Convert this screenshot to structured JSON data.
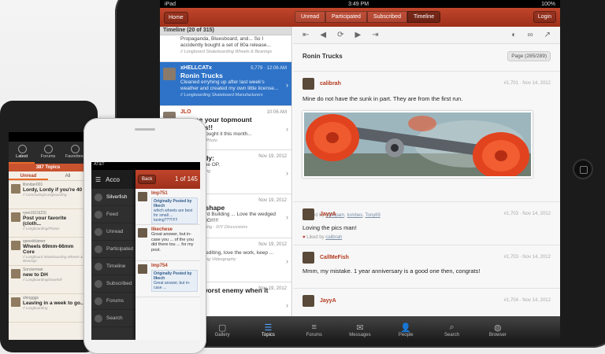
{
  "ipad": {
    "status": {
      "carrier": "iPad",
      "time": "3:49 PM",
      "battery": "100%"
    },
    "nav": {
      "home_label": "Home",
      "segments": [
        "Unread",
        "Participated",
        "Subscribed",
        "Timeline"
      ],
      "active_segment": "Timeline",
      "login_label": "Login"
    },
    "timeline_header": "Timeline (20 of 315)",
    "topics": [
      {
        "author": "",
        "meta": "",
        "title": "",
        "excerpt": "Propaganda, Bluesboard, and... So I accidently bought a set of 80a release...",
        "forum": "// Longboard Skateboarding Wheels & Bearings"
      },
      {
        "author": "xHELLCATx",
        "meta": "5,779 · 12:06 AM",
        "title": "Ronin Trucks",
        "excerpt": "Cleaned erryhing up after last week's weather and created my own little license...",
        "forum": "// Longboarding Skateboard Manufacturers"
      },
      {
        "author": "JLO",
        "meta": "10:06 AM",
        "title": "...w me your topmount ...boards!!",
        "excerpt": "...e mine, bought it this month...",
        "forum": "// Longboard Photo"
      },
      {
        "author": "",
        "meta": "Nov 19, 2012",
        "title": "...erybody:",
        "excerpt": "...cture of the OP.",
        "forum": "// Longboarding"
      },
      {
        "author": "...rederf",
        "meta": "Nov 19, 2012",
        "title": "...ck on shape",
        "excerpt": "...d for Board Building ... Love the wedged fro... JOKING!!!!!",
        "forum": "// Board Building · DIY Discussions"
      },
      {
        "author": "",
        "meta": "Nov 19, 2012",
        "title": "...88",
        "excerpt": "...ding and editing, love the work, keep ...",
        "forum": "// Longboarding Videography"
      },
      {
        "author": "",
        "meta": "Nov 19, 2012",
        "title": "...your worst enemy when it ...riding",
        "excerpt": "",
        "forum": ""
      }
    ],
    "toolbar": {
      "first": "⇤",
      "prev": "◀",
      "refresh": "⟳",
      "next": "▶",
      "last": "⇥",
      "like": "◐",
      "link": "∞",
      "share": "↗"
    },
    "thread_title": "Ronin Trucks",
    "page_badge": "Page (285/289)",
    "posts": [
      {
        "author": "calibrah",
        "meta": "#1,701 · Nov 14, 2012",
        "text": "Mine do not have the sunk in part. They are from the first run.",
        "liked": "Liked by",
        "likers": [
          "stiffspam",
          "tombes",
          "Tony89"
        ]
      },
      {
        "author": "JayyA",
        "meta": "#1,703 · Nov 14, 2012",
        "text": "Loving the pics man!",
        "liked": "Liked by",
        "likers": [
          "calibrah"
        ]
      },
      {
        "author": "CallMeFish",
        "meta": "#1,703 · Nov 14, 2012",
        "text": "Mmm, my mistake. 1 year anniversary is a good one then, congrats!",
        "liked": "",
        "likers": []
      },
      {
        "author": "JayyA",
        "meta": "#1,704 · Nov 14, 2012",
        "text": "",
        "liked": "",
        "likers": []
      }
    ],
    "tabs": [
      {
        "label": "Gallery",
        "icon": "▢"
      },
      {
        "label": "Topics",
        "icon": "☰"
      },
      {
        "label": "Forums",
        "icon": "≡"
      },
      {
        "label": "Messages",
        "icon": "✉"
      },
      {
        "label": "People",
        "icon": "👤"
      },
      {
        "label": "Search",
        "icon": "⌕"
      },
      {
        "label": "Browser",
        "icon": "◍"
      }
    ],
    "active_tab": "Topics"
  },
  "android": {
    "tabs": [
      "Latest",
      "Forums",
      "Favorites"
    ],
    "active_tab": "Latest",
    "count": "387 Topics",
    "subtabs": [
      "Unread",
      "All"
    ],
    "active_subtab": "Unread",
    "items": [
      {
        "user": "lilsndan001",
        "title": "Lordy, Lordy if you're 40",
        "forum": "// Commuting/Longboarding"
      },
      {
        "user": "ryee1510(23)",
        "title": "Post your favorite (cloth...",
        "forum": "// Longboarding/Photos"
      },
      {
        "user": "speedclamer",
        "title": "Wheels 69mm-66mm Core",
        "forum": "// Longboard Skateboarding Wheels & Bearings"
      },
      {
        "user": "Sorcierman",
        "title": "new to DH",
        "forum": "// Longboarding/Downhill"
      },
      {
        "user": "shingggs",
        "title": "Leaving in a week to go...",
        "forum": "// Longboarding"
      }
    ]
  },
  "iphone": {
    "status": "AT&T",
    "sidebar_title": "Acco",
    "sidebar_items": [
      "Silverfish",
      "Feed",
      "Unread",
      "Participated",
      "Timeline",
      "Subscribed",
      "Forums",
      "Search"
    ],
    "back_label": "Back",
    "of_label": "1 of 145",
    "posts": [
      {
        "user": "Imp751",
        "quote_by": "Originally Posted by Ilkech",
        "quote": "which wheels are best for small ... tuning???!!!!!!",
        "text": ""
      },
      {
        "user": "Ilkechese",
        "quote_by": "",
        "quote": "",
        "text": "Great answer, but in-case you ... of the you did there tou ... for my post."
      },
      {
        "user": "Imp754",
        "quote_by": "Originally Posted by Ilkech",
        "quote": "Great answer, but in-case ...",
        "text": ""
      }
    ]
  }
}
